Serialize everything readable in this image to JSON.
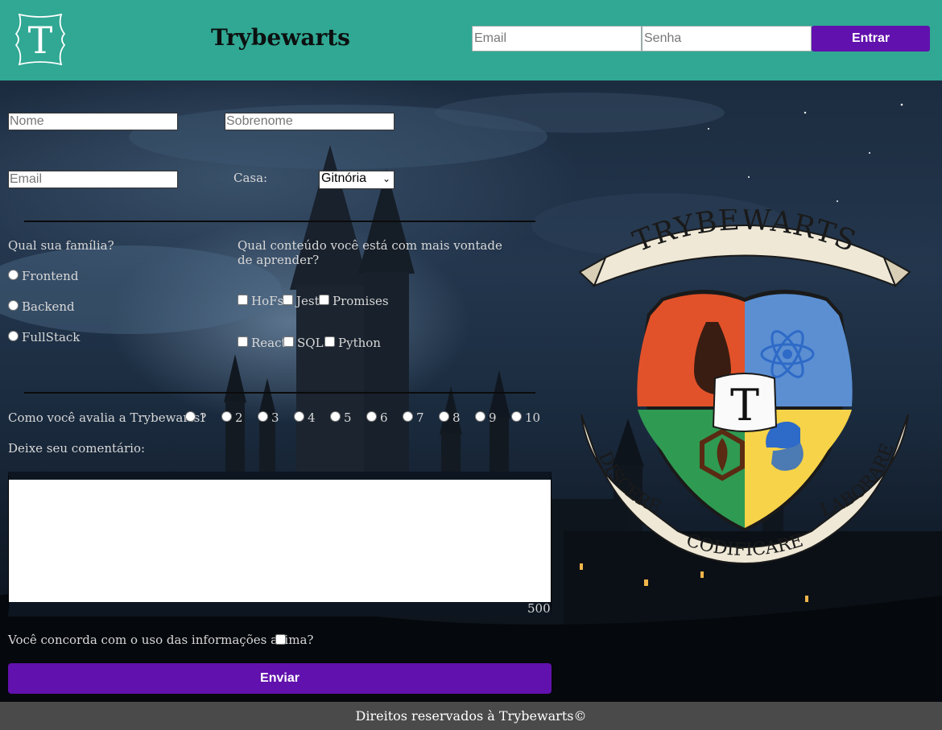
{
  "header": {
    "logo_letter": "T",
    "title": "Trybewarts",
    "login": {
      "email_placeholder": "Email",
      "password_placeholder": "Senha",
      "submit_label": "Entrar"
    }
  },
  "form": {
    "first_name_placeholder": "Nome",
    "last_name_placeholder": "Sobrenome",
    "email_placeholder": "Email",
    "house_label": "Casa:",
    "house_selected": "Gitnória",
    "family": {
      "question": "Qual sua família?",
      "options": [
        "Frontend",
        "Backend",
        "FullStack"
      ]
    },
    "content": {
      "question_line1": "Qual conteúdo você está com mais vontade",
      "question_line2": "de aprender?",
      "options": [
        "HoFs",
        "Jest",
        "Promises",
        "React",
        "SQL",
        "Python"
      ]
    },
    "rating": {
      "question": "Como você avalia a Trybewarts?",
      "options": [
        "1",
        "2",
        "3",
        "4",
        "5",
        "6",
        "7",
        "8",
        "9",
        "10"
      ]
    },
    "comment_label": "Deixe seu comentário:",
    "char_counter": "500",
    "agreement_label": "Você concorda com o uso das informações acima?",
    "submit_label": "Enviar"
  },
  "crest": {
    "banner_top": "TRYBEWARTS",
    "center_letter": "T",
    "motto_left": "DISCERE",
    "motto_bottom": "CODIFICARE",
    "motto_right": "LABORARE",
    "colors": {
      "red": "#e2522a",
      "blue": "#5b8fd2",
      "green": "#2f9a52",
      "yellow": "#f6d348",
      "parchment": "#efe8d6"
    }
  },
  "footer": {
    "text": "Direitos reservados à Trybewarts©"
  },
  "colors": {
    "header_bg": "#30a893",
    "accent_purple": "#6111ad",
    "footer_bg": "#4a4a4a"
  }
}
